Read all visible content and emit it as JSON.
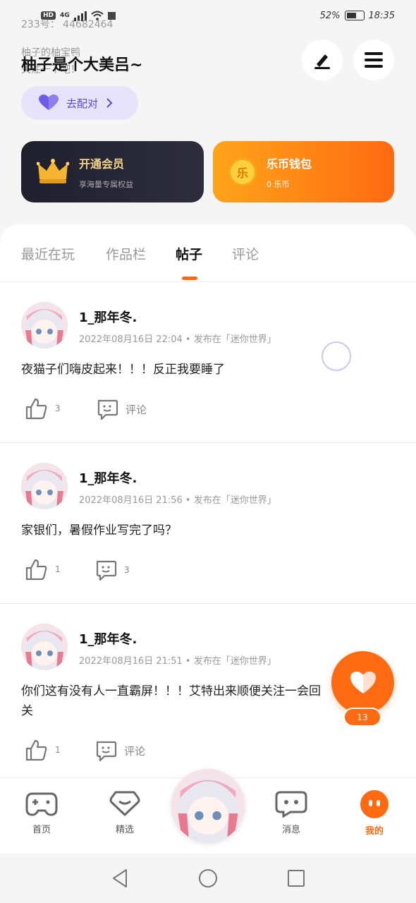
{
  "status_bar": {
    "network_badge": "HD",
    "signal_label": "4G",
    "battery_text": "52%",
    "time": "18:35"
  },
  "header": {
    "faded_id_line": "233号：  44682464",
    "faded_follow_line": "柚子的柚宝鸭",
    "faded_follow_line2": "关注一下吧！",
    "name": "柚子是个大美吕~",
    "pair_label": "去配对",
    "edit_icon": "pencil-icon",
    "menu_icon": "menu-icon"
  },
  "cards": {
    "vip": {
      "title": "开通会员",
      "subtitle": "享海量专属权益"
    },
    "wallet": {
      "title": "乐币钱包",
      "subtitle": "0 乐币",
      "coin_char": "乐"
    }
  },
  "tabs": [
    {
      "label": "最近在玩"
    },
    {
      "label": "作品栏"
    },
    {
      "label": "帖子"
    },
    {
      "label": "评论"
    }
  ],
  "posts": [
    {
      "author": "1_那年冬.",
      "meta": "2022年08月16日 22:04  •  发布在「迷你世界」",
      "content": "夜猫子们嗨皮起来！！！反正我要睡了",
      "likes": "3",
      "comments": "评论"
    },
    {
      "author": "1_那年冬.",
      "meta": "2022年08月16日 21:56  •  发布在「迷你世界」",
      "content": "家银们，暑假作业写完了吗？",
      "likes": "1",
      "comments": "3"
    },
    {
      "author": "1_那年冬.",
      "meta": "2022年08月16日 21:51  •  发布在「迷你世界」",
      "content": "你们这有没有人一直霸屏！！！艾特出来顺便关注一会回关",
      "likes": "1",
      "comments": "评论"
    }
  ],
  "fab": {
    "count": "13"
  },
  "bottom_nav": [
    {
      "label": "首页"
    },
    {
      "label": "精选"
    },
    {
      "label": "消息"
    },
    {
      "label": "我的"
    }
  ],
  "colors": {
    "accent": "#ff6a12",
    "pair_bg": "#e6e3fb",
    "pair_text": "#5a4bd1"
  }
}
